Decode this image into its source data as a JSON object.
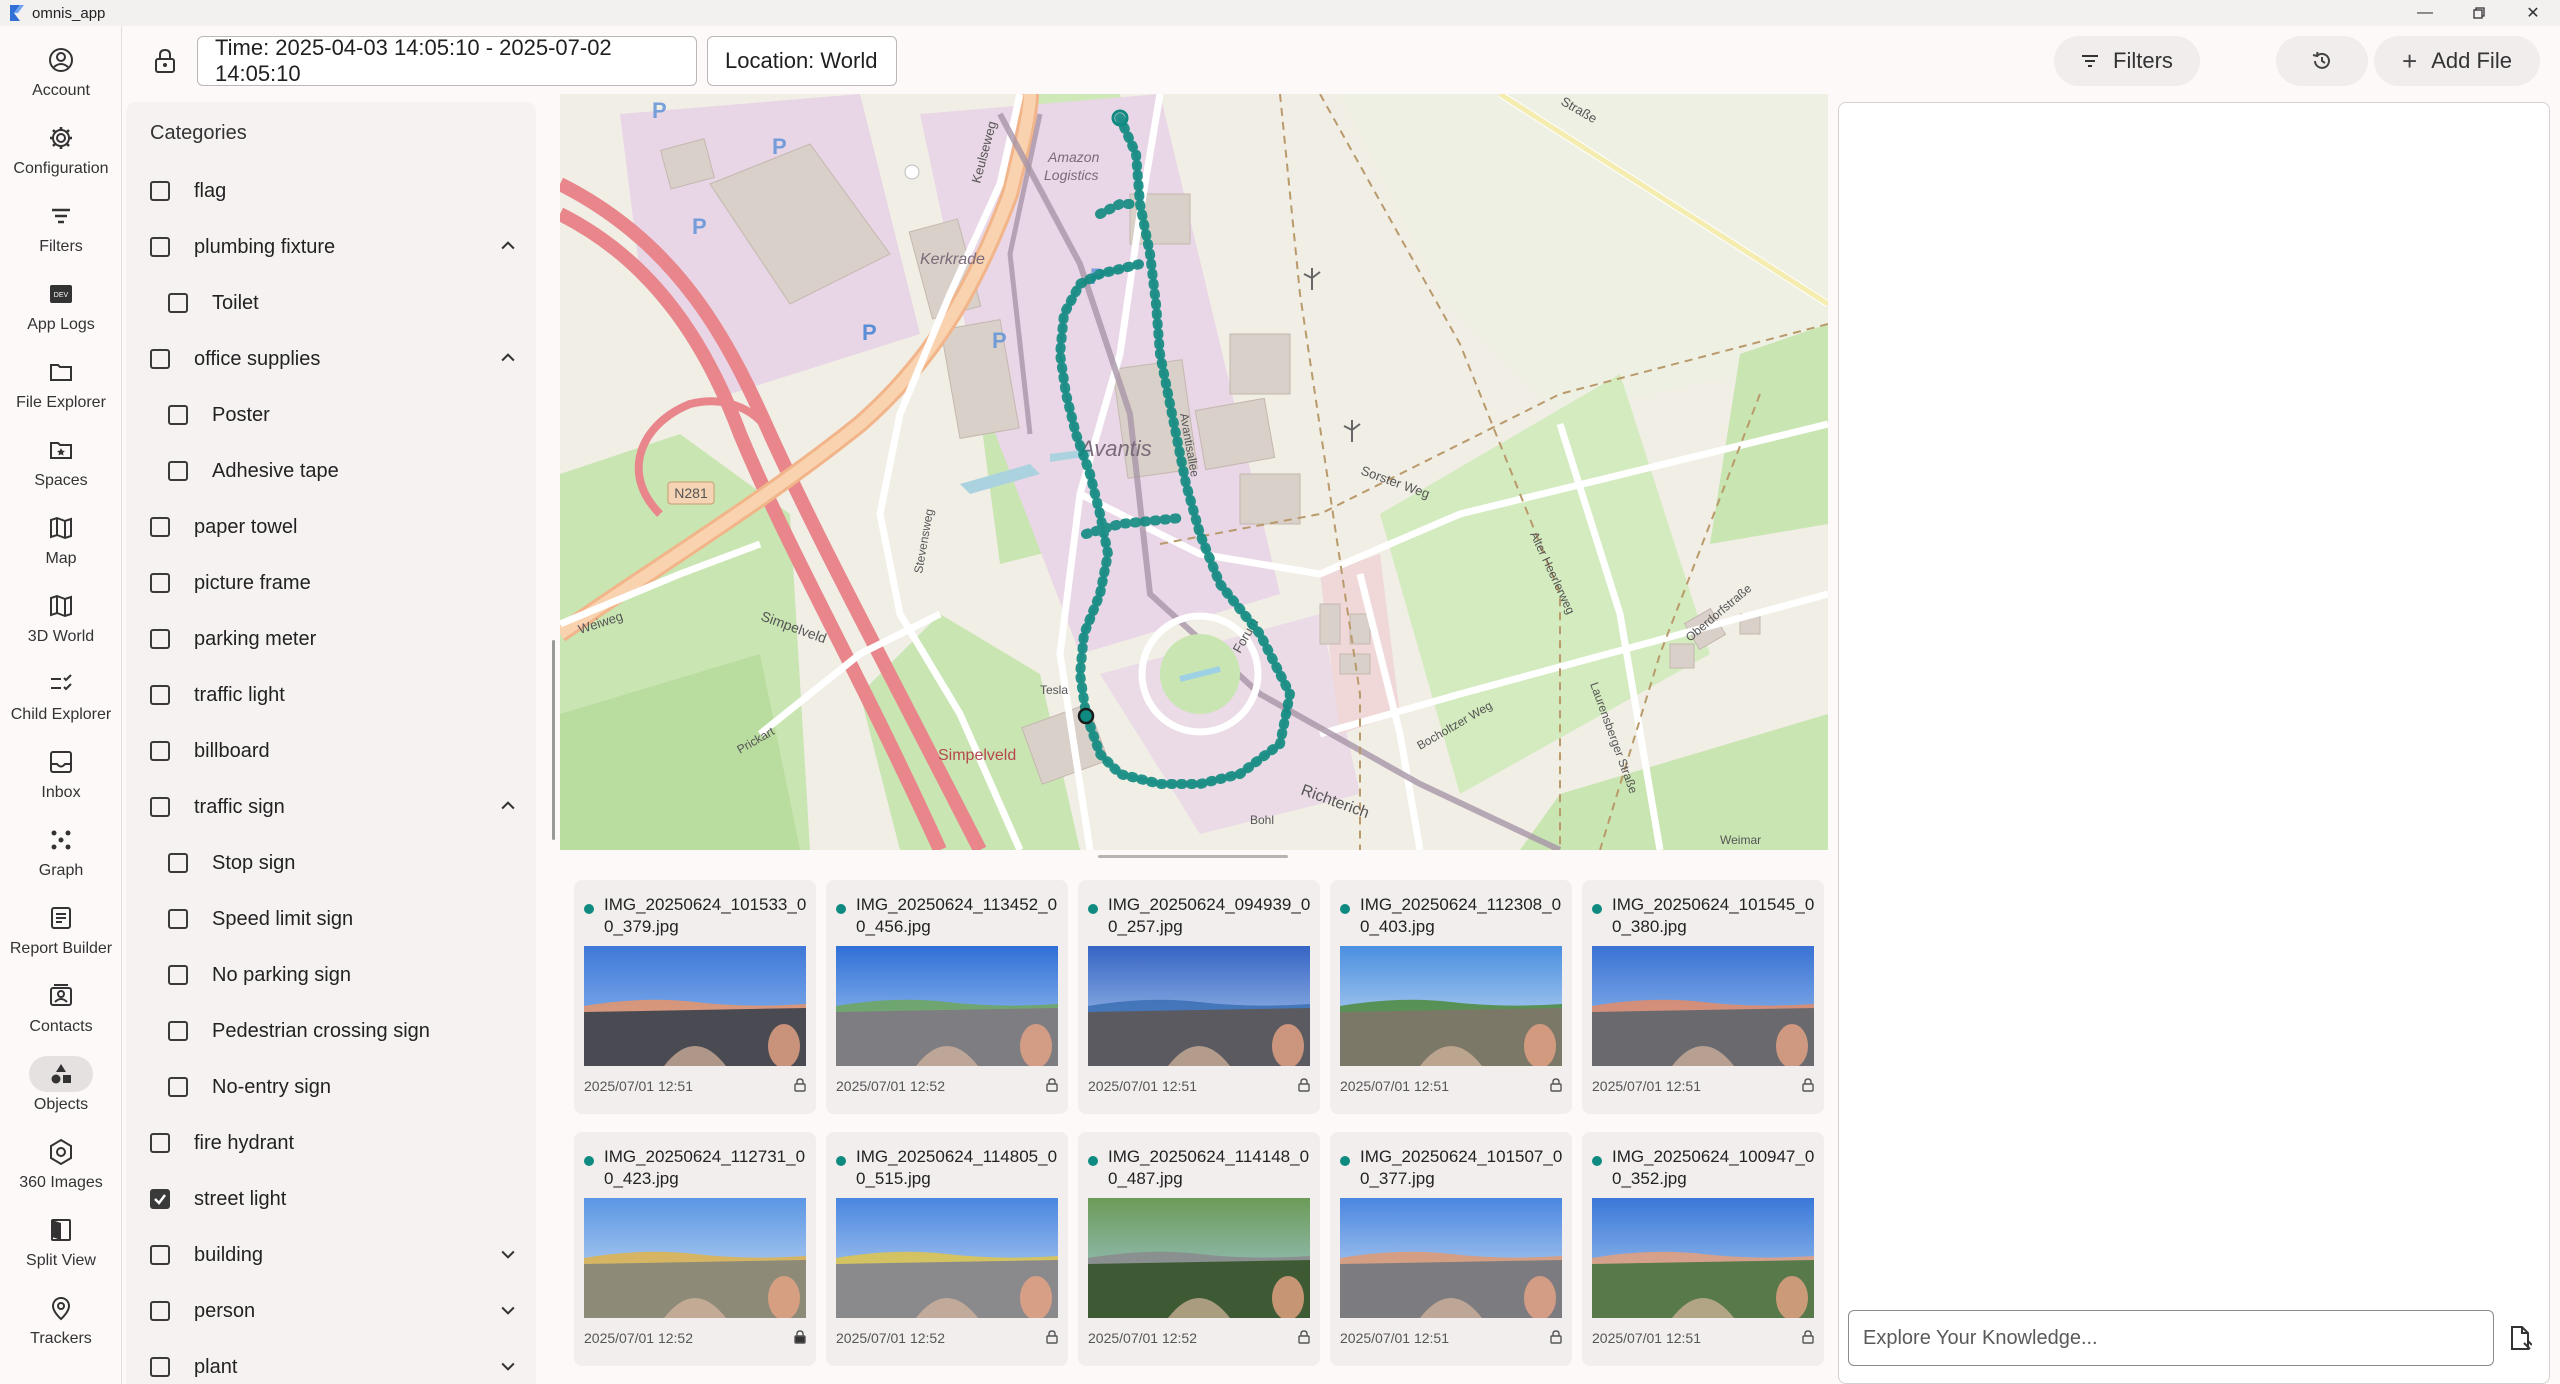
{
  "window": {
    "title": "omnis_app",
    "controls": [
      "minimize",
      "restore",
      "close"
    ]
  },
  "nav": {
    "items": [
      {
        "label": "Account",
        "icon": "account-circle-icon"
      },
      {
        "label": "Configuration",
        "icon": "gear-icon"
      },
      {
        "label": "Filters",
        "icon": "filter-lines-icon"
      },
      {
        "label": "App Logs",
        "icon": "dev-badge-icon"
      },
      {
        "label": "File Explorer",
        "icon": "folder-icon"
      },
      {
        "label": "Spaces",
        "icon": "folder-star-icon"
      },
      {
        "label": "Map",
        "icon": "map-icon"
      },
      {
        "label": "3D World",
        "icon": "map-3d-icon"
      },
      {
        "label": "Child Explorer",
        "icon": "checklist-icon"
      },
      {
        "label": "Inbox",
        "icon": "inbox-icon"
      },
      {
        "label": "Graph",
        "icon": "graph-icon"
      },
      {
        "label": "Report Builder",
        "icon": "report-icon"
      },
      {
        "label": "Contacts",
        "icon": "contacts-icon"
      },
      {
        "label": "Objects",
        "icon": "shapes-icon",
        "active": true
      },
      {
        "label": "360 Images",
        "icon": "panorama-360-icon"
      },
      {
        "label": "Split View",
        "icon": "split-view-icon"
      },
      {
        "label": "Trackers",
        "icon": "location-pin-icon"
      }
    ]
  },
  "toolbar": {
    "time_filter": "Time: 2025-04-03 14:05:10 - 2025-07-02 14:05:10",
    "location_filter": "Location: World",
    "filters_label": "Filters",
    "add_file_label": "Add File"
  },
  "categories": {
    "title": "Categories",
    "rows": [
      {
        "label": "flag",
        "level": 0,
        "checked": false,
        "chevron": ""
      },
      {
        "label": "plumbing fixture",
        "level": 0,
        "checked": false,
        "chevron": "up"
      },
      {
        "label": "Toilet",
        "level": 1,
        "checked": false,
        "chevron": ""
      },
      {
        "label": "office supplies",
        "level": 0,
        "checked": false,
        "chevron": "up"
      },
      {
        "label": "Poster",
        "level": 1,
        "checked": false,
        "chevron": ""
      },
      {
        "label": "Adhesive tape",
        "level": 1,
        "checked": false,
        "chevron": ""
      },
      {
        "label": "paper towel",
        "level": 0,
        "checked": false,
        "chevron": ""
      },
      {
        "label": "picture frame",
        "level": 0,
        "checked": false,
        "chevron": ""
      },
      {
        "label": "parking meter",
        "level": 0,
        "checked": false,
        "chevron": ""
      },
      {
        "label": "traffic light",
        "level": 0,
        "checked": false,
        "chevron": ""
      },
      {
        "label": "billboard",
        "level": 0,
        "checked": false,
        "chevron": ""
      },
      {
        "label": "traffic sign",
        "level": 0,
        "checked": false,
        "chevron": "up"
      },
      {
        "label": "Stop sign",
        "level": 1,
        "checked": false,
        "chevron": ""
      },
      {
        "label": "Speed limit sign",
        "level": 1,
        "checked": false,
        "chevron": ""
      },
      {
        "label": "No parking sign",
        "level": 1,
        "checked": false,
        "chevron": ""
      },
      {
        "label": "Pedestrian crossing sign",
        "level": 1,
        "checked": false,
        "chevron": ""
      },
      {
        "label": "No-entry sign",
        "level": 1,
        "checked": false,
        "chevron": ""
      },
      {
        "label": "fire hydrant",
        "level": 0,
        "checked": false,
        "chevron": ""
      },
      {
        "label": "street light",
        "level": 0,
        "checked": true,
        "chevron": ""
      },
      {
        "label": "building",
        "level": 0,
        "checked": false,
        "chevron": "down"
      },
      {
        "label": "person",
        "level": 0,
        "checked": false,
        "chevron": "down"
      },
      {
        "label": "plant",
        "level": 0,
        "checked": false,
        "chevron": "down"
      }
    ]
  },
  "map": {
    "labels": {
      "kerkrade": "Kerkrade",
      "amazon": "Amazon",
      "logistics": "Logistics",
      "avantis": "Avantis",
      "n281": "N281",
      "simpelveld": "Simpelveld",
      "simpelveld2": "Simpelveld",
      "weiweg": "Weiweg",
      "stevensweg": "Stevensweg",
      "tesla": "Tesla",
      "forum": "Forum",
      "richterich": "Richterich",
      "keulseweg": "Keulseweg",
      "sorsterweg": "Sorster Weg",
      "bocholtzer": "Bocholtzer Weg",
      "oberdorf": "Oberdorfstraße",
      "strasse": "Straße",
      "prickart": "Prickart",
      "avantisallee": "Avantisallee",
      "laurens": "Laurensberger Straße",
      "alteheer": "Alter Heerlerweg",
      "weimar": "Weimar",
      "bohl": "Bohl"
    },
    "colors": {
      "route": "#0f8a80",
      "motorway": "#e8868c",
      "primary": "#f7c7a0",
      "industrial": "#e9d6e6",
      "green": "#c8e6b0"
    }
  },
  "images": [
    {
      "name": "IMG_20250624_101533_00_379.jpg",
      "date": "2025/07/01 12:51",
      "locked": false
    },
    {
      "name": "IMG_20250624_113452_00_456.jpg",
      "date": "2025/07/01 12:52",
      "locked": false
    },
    {
      "name": "IMG_20250624_094939_00_257.jpg",
      "date": "2025/07/01 12:51",
      "locked": false
    },
    {
      "name": "IMG_20250624_112308_00_403.jpg",
      "date": "2025/07/01 12:51",
      "locked": false
    },
    {
      "name": "IMG_20250624_101545_00_380.jpg",
      "date": "2025/07/01 12:51",
      "locked": false
    },
    {
      "name": "IMG_20250624_112731_00_423.jpg",
      "date": "2025/07/01 12:52",
      "locked": true
    },
    {
      "name": "IMG_20250624_114805_00_515.jpg",
      "date": "2025/07/01 12:52",
      "locked": false
    },
    {
      "name": "IMG_20250624_114148_00_487.jpg",
      "date": "2025/07/01 12:52",
      "locked": false
    },
    {
      "name": "IMG_20250624_101507_00_377.jpg",
      "date": "2025/07/01 12:51",
      "locked": false
    },
    {
      "name": "IMG_20250624_100947_00_352.jpg",
      "date": "2025/07/01 12:51",
      "locked": false
    }
  ],
  "knowledge": {
    "placeholder": "Explore Your Knowledge..."
  }
}
